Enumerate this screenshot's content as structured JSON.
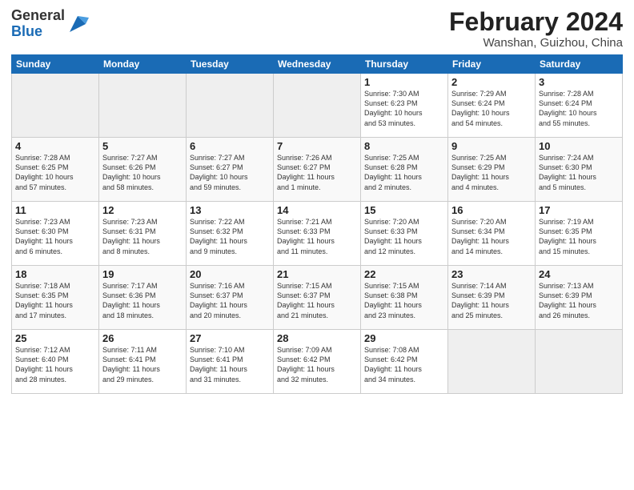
{
  "header": {
    "logo_general": "General",
    "logo_blue": "Blue",
    "month_year": "February 2024",
    "location": "Wanshan, Guizhou, China"
  },
  "weekdays": [
    "Sunday",
    "Monday",
    "Tuesday",
    "Wednesday",
    "Thursday",
    "Friday",
    "Saturday"
  ],
  "weeks": [
    [
      {
        "day": "",
        "info": ""
      },
      {
        "day": "",
        "info": ""
      },
      {
        "day": "",
        "info": ""
      },
      {
        "day": "",
        "info": ""
      },
      {
        "day": "1",
        "info": "Sunrise: 7:30 AM\nSunset: 6:23 PM\nDaylight: 10 hours\nand 53 minutes."
      },
      {
        "day": "2",
        "info": "Sunrise: 7:29 AM\nSunset: 6:24 PM\nDaylight: 10 hours\nand 54 minutes."
      },
      {
        "day": "3",
        "info": "Sunrise: 7:28 AM\nSunset: 6:24 PM\nDaylight: 10 hours\nand 55 minutes."
      }
    ],
    [
      {
        "day": "4",
        "info": "Sunrise: 7:28 AM\nSunset: 6:25 PM\nDaylight: 10 hours\nand 57 minutes."
      },
      {
        "day": "5",
        "info": "Sunrise: 7:27 AM\nSunset: 6:26 PM\nDaylight: 10 hours\nand 58 minutes."
      },
      {
        "day": "6",
        "info": "Sunrise: 7:27 AM\nSunset: 6:27 PM\nDaylight: 10 hours\nand 59 minutes."
      },
      {
        "day": "7",
        "info": "Sunrise: 7:26 AM\nSunset: 6:27 PM\nDaylight: 11 hours\nand 1 minute."
      },
      {
        "day": "8",
        "info": "Sunrise: 7:25 AM\nSunset: 6:28 PM\nDaylight: 11 hours\nand 2 minutes."
      },
      {
        "day": "9",
        "info": "Sunrise: 7:25 AM\nSunset: 6:29 PM\nDaylight: 11 hours\nand 4 minutes."
      },
      {
        "day": "10",
        "info": "Sunrise: 7:24 AM\nSunset: 6:30 PM\nDaylight: 11 hours\nand 5 minutes."
      }
    ],
    [
      {
        "day": "11",
        "info": "Sunrise: 7:23 AM\nSunset: 6:30 PM\nDaylight: 11 hours\nand 6 minutes."
      },
      {
        "day": "12",
        "info": "Sunrise: 7:23 AM\nSunset: 6:31 PM\nDaylight: 11 hours\nand 8 minutes."
      },
      {
        "day": "13",
        "info": "Sunrise: 7:22 AM\nSunset: 6:32 PM\nDaylight: 11 hours\nand 9 minutes."
      },
      {
        "day": "14",
        "info": "Sunrise: 7:21 AM\nSunset: 6:33 PM\nDaylight: 11 hours\nand 11 minutes."
      },
      {
        "day": "15",
        "info": "Sunrise: 7:20 AM\nSunset: 6:33 PM\nDaylight: 11 hours\nand 12 minutes."
      },
      {
        "day": "16",
        "info": "Sunrise: 7:20 AM\nSunset: 6:34 PM\nDaylight: 11 hours\nand 14 minutes."
      },
      {
        "day": "17",
        "info": "Sunrise: 7:19 AM\nSunset: 6:35 PM\nDaylight: 11 hours\nand 15 minutes."
      }
    ],
    [
      {
        "day": "18",
        "info": "Sunrise: 7:18 AM\nSunset: 6:35 PM\nDaylight: 11 hours\nand 17 minutes."
      },
      {
        "day": "19",
        "info": "Sunrise: 7:17 AM\nSunset: 6:36 PM\nDaylight: 11 hours\nand 18 minutes."
      },
      {
        "day": "20",
        "info": "Sunrise: 7:16 AM\nSunset: 6:37 PM\nDaylight: 11 hours\nand 20 minutes."
      },
      {
        "day": "21",
        "info": "Sunrise: 7:15 AM\nSunset: 6:37 PM\nDaylight: 11 hours\nand 21 minutes."
      },
      {
        "day": "22",
        "info": "Sunrise: 7:15 AM\nSunset: 6:38 PM\nDaylight: 11 hours\nand 23 minutes."
      },
      {
        "day": "23",
        "info": "Sunrise: 7:14 AM\nSunset: 6:39 PM\nDaylight: 11 hours\nand 25 minutes."
      },
      {
        "day": "24",
        "info": "Sunrise: 7:13 AM\nSunset: 6:39 PM\nDaylight: 11 hours\nand 26 minutes."
      }
    ],
    [
      {
        "day": "25",
        "info": "Sunrise: 7:12 AM\nSunset: 6:40 PM\nDaylight: 11 hours\nand 28 minutes."
      },
      {
        "day": "26",
        "info": "Sunrise: 7:11 AM\nSunset: 6:41 PM\nDaylight: 11 hours\nand 29 minutes."
      },
      {
        "day": "27",
        "info": "Sunrise: 7:10 AM\nSunset: 6:41 PM\nDaylight: 11 hours\nand 31 minutes."
      },
      {
        "day": "28",
        "info": "Sunrise: 7:09 AM\nSunset: 6:42 PM\nDaylight: 11 hours\nand 32 minutes."
      },
      {
        "day": "29",
        "info": "Sunrise: 7:08 AM\nSunset: 6:42 PM\nDaylight: 11 hours\nand 34 minutes."
      },
      {
        "day": "",
        "info": ""
      },
      {
        "day": "",
        "info": ""
      }
    ]
  ]
}
